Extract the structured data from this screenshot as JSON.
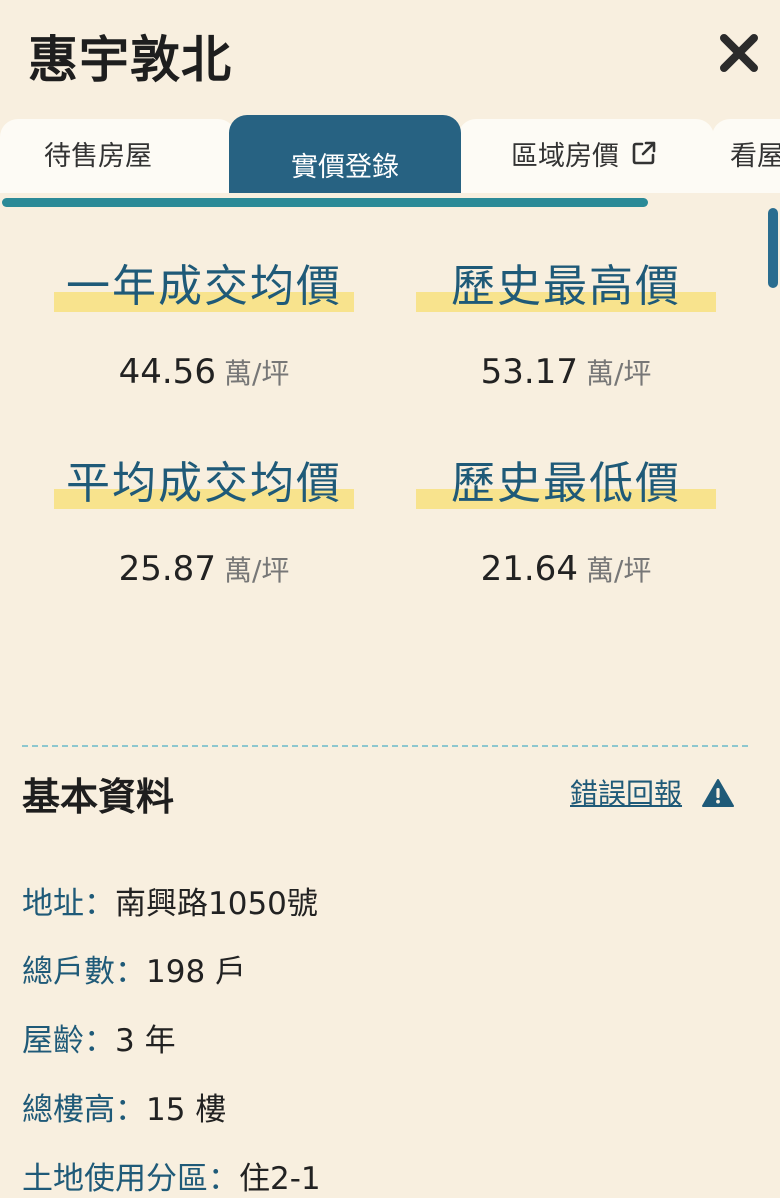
{
  "header": {
    "title": "惠宇敦北"
  },
  "tabs": [
    {
      "label": "待售房屋"
    },
    {
      "label": "實價登錄"
    },
    {
      "label": "區域房價"
    },
    {
      "label": "看屋"
    }
  ],
  "stats": [
    {
      "title": "一年成交均價",
      "value": "44.56",
      "unit": "萬/坪"
    },
    {
      "title": "歷史最高價",
      "value": "53.17",
      "unit": "萬/坪"
    },
    {
      "title": "平均成交均價",
      "value": "25.87",
      "unit": "萬/坪"
    },
    {
      "title": "歷史最低價",
      "value": "21.64",
      "unit": "萬/坪"
    }
  ],
  "basic_info": {
    "title": "基本資料",
    "report_label": "錯誤回報",
    "rows": [
      {
        "label": "地址：",
        "value": "南興路1050號"
      },
      {
        "label": "總戶數：",
        "value": "198 戶"
      },
      {
        "label": "屋齡：",
        "value": "3 年"
      },
      {
        "label": "總樓高：",
        "value": "15 樓"
      },
      {
        "label": "土地使用分區：",
        "value": "住2-1"
      }
    ]
  },
  "colors": {
    "background": "#f8efdf",
    "active_tab": "#276282",
    "accent": "#2b8a97",
    "label_blue": "#1f5a78",
    "highlight": "#f8e38d"
  },
  "icons": {
    "close": "close-icon",
    "external": "external-link-icon",
    "warning": "warning-icon"
  }
}
